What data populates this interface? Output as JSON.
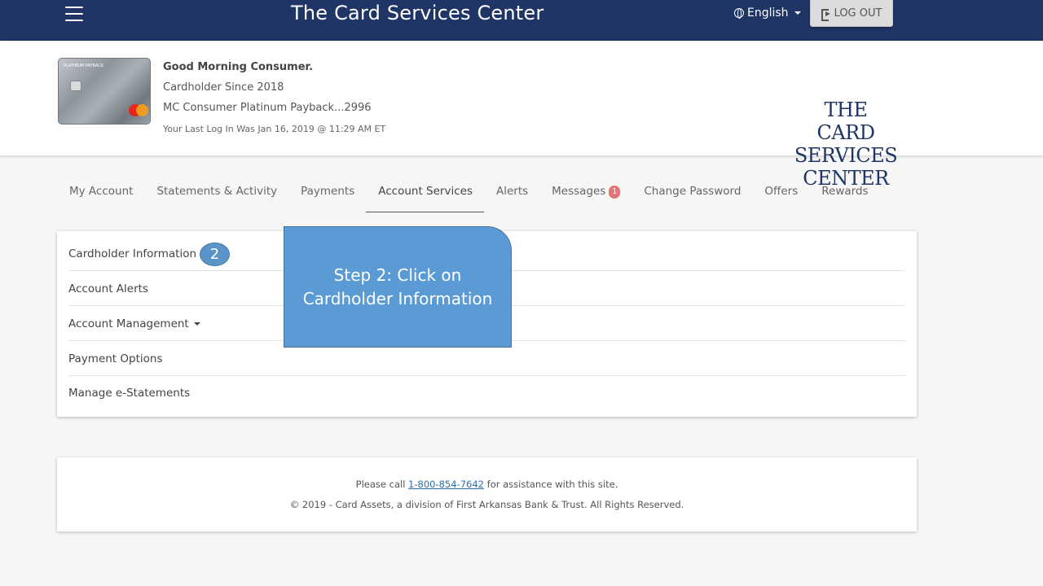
{
  "topbar": {
    "title": "The Card Services Center",
    "language": "English",
    "logout_label": "LOG OUT"
  },
  "header": {
    "card_brand_text": "PLATINUM PAYBACK",
    "greeting": "Good Morning Consumer.",
    "cardholder_since": "Cardholder Since 2018",
    "account_name": "MC Consumer Platinum Payback...2996",
    "last_login": "Your Last Log In Was Jan 16, 2019 @ 11:29 AM ET",
    "logo_lines": [
      "THE",
      "CARD SERVICES",
      "CENTER"
    ]
  },
  "nav": {
    "items": [
      {
        "label": "My Account"
      },
      {
        "label": "Statements & Activity"
      },
      {
        "label": "Payments"
      },
      {
        "label": "Account Services"
      },
      {
        "label": "Alerts"
      },
      {
        "label": "Messages",
        "badge": "1"
      },
      {
        "label": "Change Password"
      },
      {
        "label": "Offers"
      },
      {
        "label": "Rewards"
      }
    ],
    "active": "Account Services"
  },
  "services": {
    "items": [
      {
        "label": "Cardholder Information"
      },
      {
        "label": "Account Alerts"
      },
      {
        "label": "Account Management"
      },
      {
        "label": "Payment Options"
      },
      {
        "label": "Manage e-Statements"
      }
    ]
  },
  "tutorial": {
    "step_number": "2",
    "callout_text": "Step 2: Click on Cardholder Information"
  },
  "footer": {
    "call_prefix": "Please call",
    "phone": "1-800-854-7642",
    "call_suffix": "for assistance with this site.",
    "copyright": "© 2019 - Card Assets, a division of First Arkansas Bank & Trust. All Rights Reserved."
  },
  "colors": {
    "topbar": "#1f3565",
    "callout": "#5b9bd5",
    "badge": "#e57373",
    "link": "#2a6fb0"
  }
}
